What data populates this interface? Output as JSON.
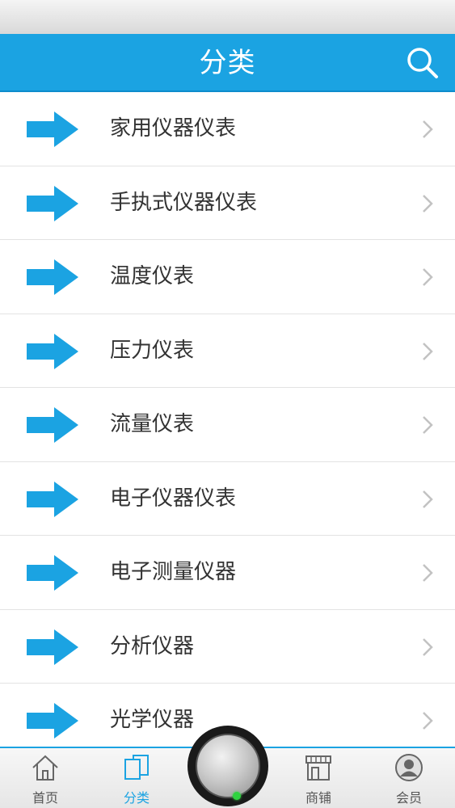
{
  "header": {
    "title": "分类",
    "search_icon": "search-icon",
    "bg_color": "#1ba3e2"
  },
  "categories": [
    {
      "label": "家用仪器仪表"
    },
    {
      "label": "手执式仪器仪表"
    },
    {
      "label": "温度仪表"
    },
    {
      "label": "压力仪表"
    },
    {
      "label": "流量仪表"
    },
    {
      "label": "电子仪器仪表"
    },
    {
      "label": "电子测量仪器"
    },
    {
      "label": "分析仪器"
    },
    {
      "label": "光学仪器"
    }
  ],
  "tabbar": {
    "tabs": [
      {
        "label": "首页",
        "icon": "home-icon"
      },
      {
        "label": "分类",
        "icon": "category-icon",
        "active": true
      },
      {
        "label": "商铺",
        "icon": "shop-icon"
      },
      {
        "label": "会员",
        "icon": "member-icon"
      }
    ],
    "center_icon": "center-knob-icon",
    "active_color": "#1ba3e2"
  }
}
